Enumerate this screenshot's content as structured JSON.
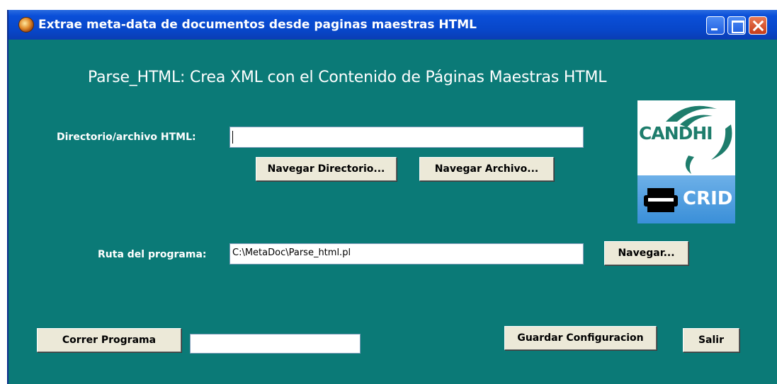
{
  "window": {
    "title": "Extrae meta-data de documentos desde paginas maestras HTML",
    "controls": {
      "minimize": "minimize-icon",
      "maximize": "maximize-icon",
      "close": "close-icon"
    }
  },
  "main": {
    "heading": "Parse_HTML: Crea XML con el Contenido de Páginas Maestras HTML",
    "html_path": {
      "label": "Directorio/archivo HTML:",
      "value": ""
    },
    "browse_directory_label": "Navegar Directorio...",
    "browse_file_label": "Navegar Archivo...",
    "program_path": {
      "label": "Ruta del programa:",
      "value": "C:\\MetaDoc\\Parse_html.pl"
    },
    "browse_label": "Navegar...",
    "run_label": "Correr Programa",
    "status_value": "",
    "save_config_label": "Guardar Configuracion",
    "exit_label": "Salir"
  },
  "logo": {
    "top_text": "CANDHI",
    "bottom_text": "CRID"
  },
  "colors": {
    "background": "#0b7a77",
    "titlebar": "#0846c8",
    "button_face": "#ece9d8",
    "logo_green": "#1e7d6c",
    "logo_blue": "#3a8fd8"
  }
}
